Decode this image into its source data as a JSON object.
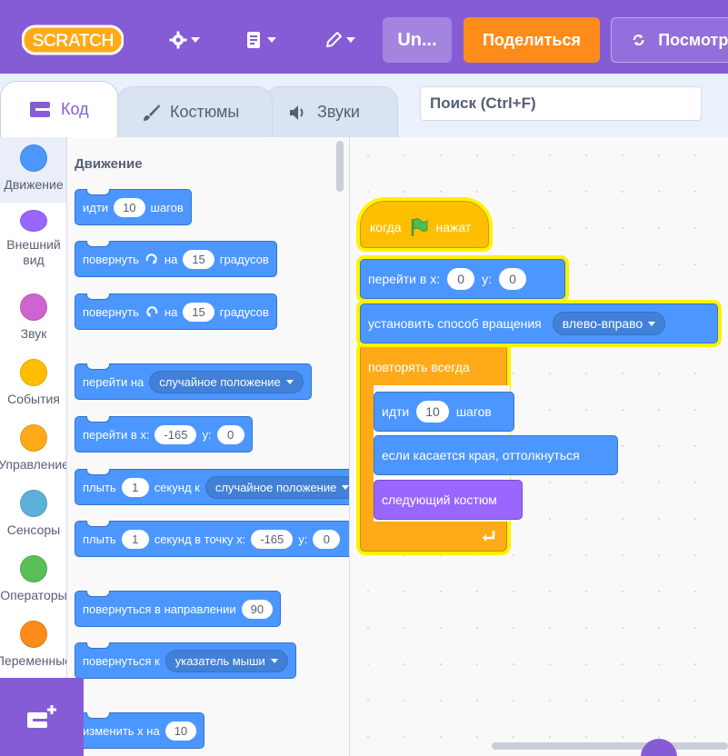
{
  "app": {
    "title_field": "Un...",
    "share_label": "Поделиться",
    "see_project_label": "Посмотреть",
    "icons": [
      "scratch-logo",
      "gear-icon",
      "file-icon",
      "edit-pencil-icon",
      "refresh-icon",
      "extension-add-icon"
    ]
  },
  "colors": {
    "menubar": "#855cd6",
    "share": "#ff8c1a",
    "motion": "#4c97ff",
    "looks": "#9966ff",
    "events": "#ffbf00",
    "control": "#ffab19",
    "highlight": "#fff200"
  },
  "tabs": [
    {
      "label": "Код",
      "icon": "code-icon",
      "active": true
    },
    {
      "label": "Костюмы",
      "icon": "brush-icon",
      "active": false
    },
    {
      "label": "Звуки",
      "icon": "speaker-icon",
      "active": false
    }
  ],
  "search": {
    "placeholder": "Поиск (Ctrl+F)"
  },
  "categories": [
    {
      "label": "Движение",
      "color": "#4c97ff"
    },
    {
      "label": "Внешний вид",
      "color": "#9966ff"
    },
    {
      "label": "Звук",
      "color": "#cf63cf"
    },
    {
      "label": "События",
      "color": "#ffbf00"
    },
    {
      "label": "Управление",
      "color": "#ffab19"
    },
    {
      "label": "Сенсоры",
      "color": "#5cb1d6"
    },
    {
      "label": "Операторы",
      "color": "#59c059"
    },
    {
      "label": "Переменные",
      "color": "#ff8c1a"
    }
  ],
  "palette": {
    "heading": "Движение",
    "blocks": {
      "move": {
        "t1": "идти",
        "v1": "10",
        "t2": "шагов"
      },
      "turn_right": {
        "t1": "повернуть",
        "t2": "на",
        "v1": "15",
        "t3": "градусов"
      },
      "turn_left": {
        "t1": "повернуть",
        "t2": "на",
        "v1": "15",
        "t3": "градусов"
      },
      "goto": {
        "t1": "перейти на",
        "d1": "случайное положение"
      },
      "goto_xy": {
        "t1": "перейти в x:",
        "v1": "-165",
        "t2": "y:",
        "v2": "0"
      },
      "glide": {
        "t1": "плыть",
        "v1": "1",
        "t2": "секунд к",
        "d1": "случайное положение"
      },
      "glide_xy": {
        "t1": "плыть",
        "v1": "1",
        "t2": "секунд в точку x:",
        "v2": "-165",
        "t3": "y:",
        "v3": "0"
      },
      "point_dir": {
        "t1": "повернуться в направлении",
        "v1": "90"
      },
      "point_to": {
        "t1": "повернуться к",
        "d1": "указатель мыши"
      },
      "change_x": {
        "t1": "изменить х на",
        "v1": "10"
      }
    }
  },
  "script": {
    "when_flag": {
      "t1": "когда",
      "t2": "нажат"
    },
    "goto_xy": {
      "t1": "перейти в x:",
      "v1": "0",
      "t2": "y:",
      "v2": "0"
    },
    "rotation": {
      "t1": "установить способ вращения",
      "d1": "влево-вправо"
    },
    "forever": {
      "t1": "повторять всегда"
    },
    "move": {
      "t1": "идти",
      "v1": "10",
      "t2": "шагов"
    },
    "bounce": {
      "t1": "если касается края, оттолкнуться"
    },
    "next_costume": {
      "t1": "следующий костюм"
    }
  }
}
